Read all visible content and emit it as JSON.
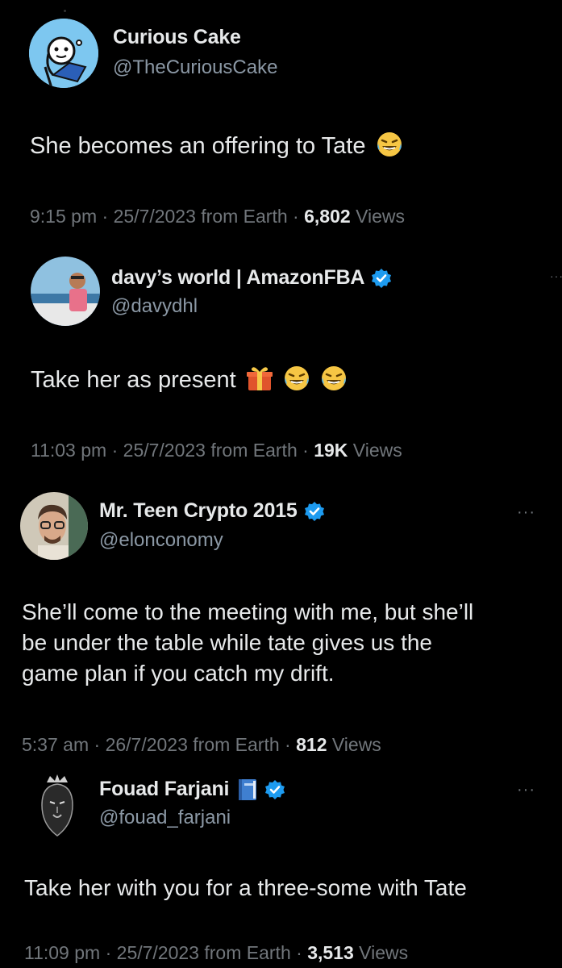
{
  "tweets": [
    {
      "display_name": "Curious Cake",
      "handle": "@TheCuriousCake",
      "verified": false,
      "text": "She becomes an offering to Tate",
      "emojis": [
        "laughing-crying-emoji"
      ],
      "time": "9:15 pm",
      "date": "25/7/2023",
      "source": "from Earth",
      "views_count": "6,802",
      "views_label": "Views"
    },
    {
      "display_name": "davy’s world | AmazonFBA",
      "handle": "@davydhl",
      "verified": true,
      "text": "Take her as present",
      "emojis": [
        "gift-emoji",
        "laughing-crying-emoji",
        "laughing-crying-emoji"
      ],
      "time": "11:03 pm",
      "date": "25/7/2023",
      "source": "from Earth",
      "views_count": "19K",
      "views_label": "Views"
    },
    {
      "display_name": "Mr. Teen Crypto 2015",
      "handle": "@elonconomy",
      "verified": true,
      "text_lines": [
        "She’ll come to the meeting with me, but she’ll",
        "be under the table while tate gives us the",
        "game plan if you catch my drift."
      ],
      "time": "5:37 am",
      "date": "26/7/2023",
      "source": "from Earth",
      "views_count": "812",
      "views_label": "Views"
    },
    {
      "display_name": "Fouad Farjani",
      "handle": "@fouad_farjani",
      "verified": true,
      "name_emoji": "blue-book-emoji",
      "text": "Take her with you for a three-some with Tate",
      "time": "11:09 pm",
      "date": "25/7/2023",
      "source": "from Earth",
      "views_count": "3,513",
      "views_label": "Views"
    }
  ],
  "colors": {
    "background": "#000000",
    "primary_text": "#e7e9ea",
    "secondary_text": "#71767b",
    "handle_text": "#8b98a5",
    "verified_blue": "#1d9bf0"
  },
  "meta_separator": "·",
  "more_label": "···"
}
